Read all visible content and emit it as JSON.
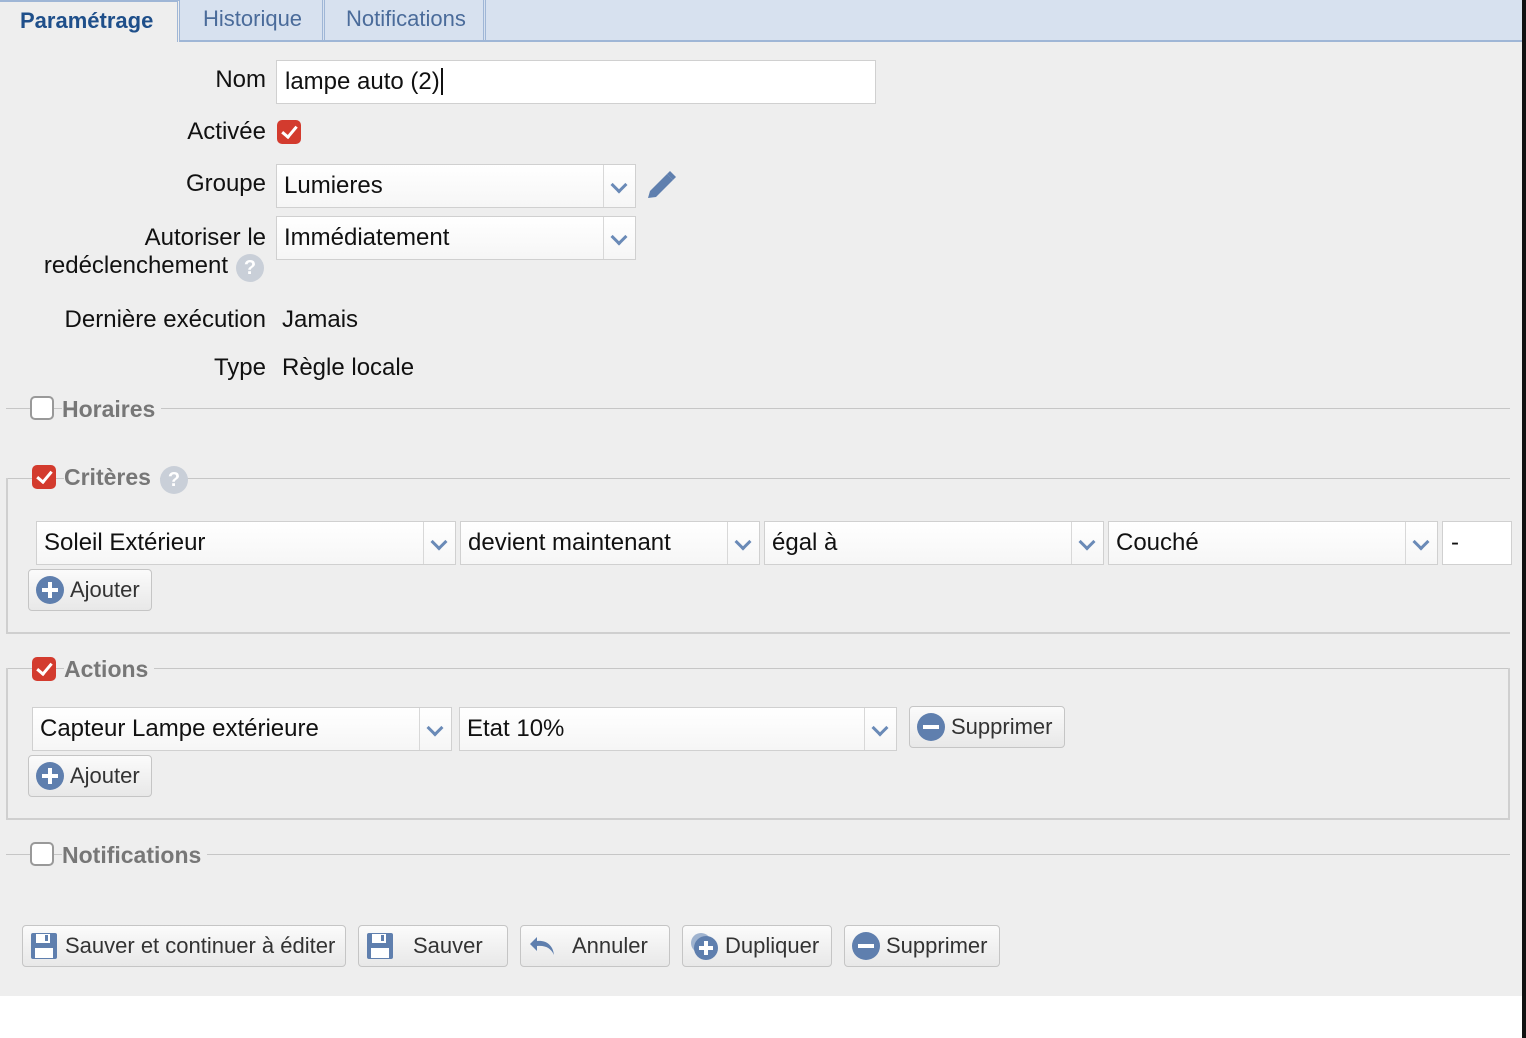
{
  "tabs": [
    "Paramétrage",
    "Historique",
    "Notifications"
  ],
  "form": {
    "nom_label": "Nom",
    "nom_value": "lampe auto (2)",
    "activee_label": "Activée",
    "groupe_label": "Groupe",
    "groupe_value": "Lumieres",
    "autoriser_label_1": "Autoriser le",
    "autoriser_label_2": "redéclenchement",
    "autoriser_value": "Immédiatement",
    "derniere_label": "Dernière exécution",
    "derniere_value": "Jamais",
    "type_label": "Type",
    "type_value": "Règle locale"
  },
  "sections": {
    "horaires": "Horaires",
    "criteres": "Critères",
    "actions": "Actions",
    "notifications": "Notifications"
  },
  "criteres": {
    "field1": "Soleil Extérieur",
    "field2": "devient maintenant",
    "field3": "égal à",
    "field4": "Couché",
    "field5": "-",
    "add_label": "Ajouter"
  },
  "actions": {
    "field1": "Capteur Lampe extérieure",
    "field2": "Etat 10%",
    "delete_label": "Supprimer",
    "add_label": "Ajouter"
  },
  "footer": {
    "save_continue": "Sauver et continuer à éditer",
    "save": "Sauver",
    "cancel": "Annuler",
    "duplicate": "Dupliquer",
    "delete": "Supprimer"
  },
  "checkbox_state": {
    "activee": true,
    "horaires": false,
    "criteres": true,
    "actions": true,
    "notifications": false
  },
  "colors": {
    "accent": "#1f4f8a",
    "tab_bg": "#d7e1ef",
    "checkbox_on": "#d33b2e",
    "panel_bg": "#eeeeee"
  }
}
